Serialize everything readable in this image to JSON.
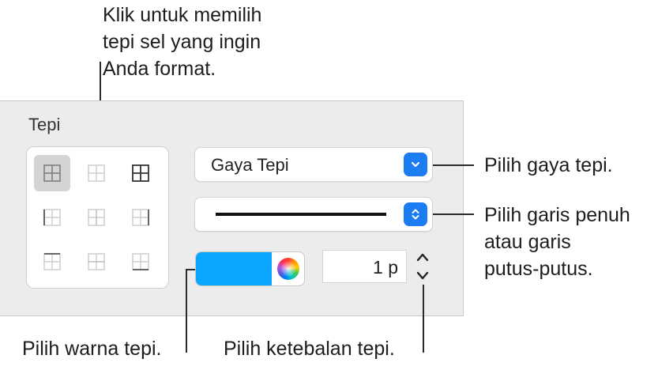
{
  "callouts": {
    "edge_select": [
      "Klik untuk memilih",
      "tepi sel yang ingin",
      "Anda format."
    ],
    "border_style": "Pilih gaya tepi.",
    "line_type": [
      "Pilih garis penuh",
      "atau garis",
      "putus-putus."
    ],
    "color": "Pilih warna tepi.",
    "thickness": "Pilih ketebalan tepi."
  },
  "panel": {
    "title": "Tepi",
    "style_popup_label": "Gaya Tepi",
    "thickness_value": "1 p",
    "color_hex": "#0aa6ff",
    "accent_color": "#1c7cf2"
  },
  "border_buttons": [
    "all-borders",
    "inside-borders",
    "outside-borders",
    "left-border",
    "inside-vertical-border",
    "right-border",
    "top-border",
    "inside-horizontal-border",
    "bottom-border"
  ]
}
